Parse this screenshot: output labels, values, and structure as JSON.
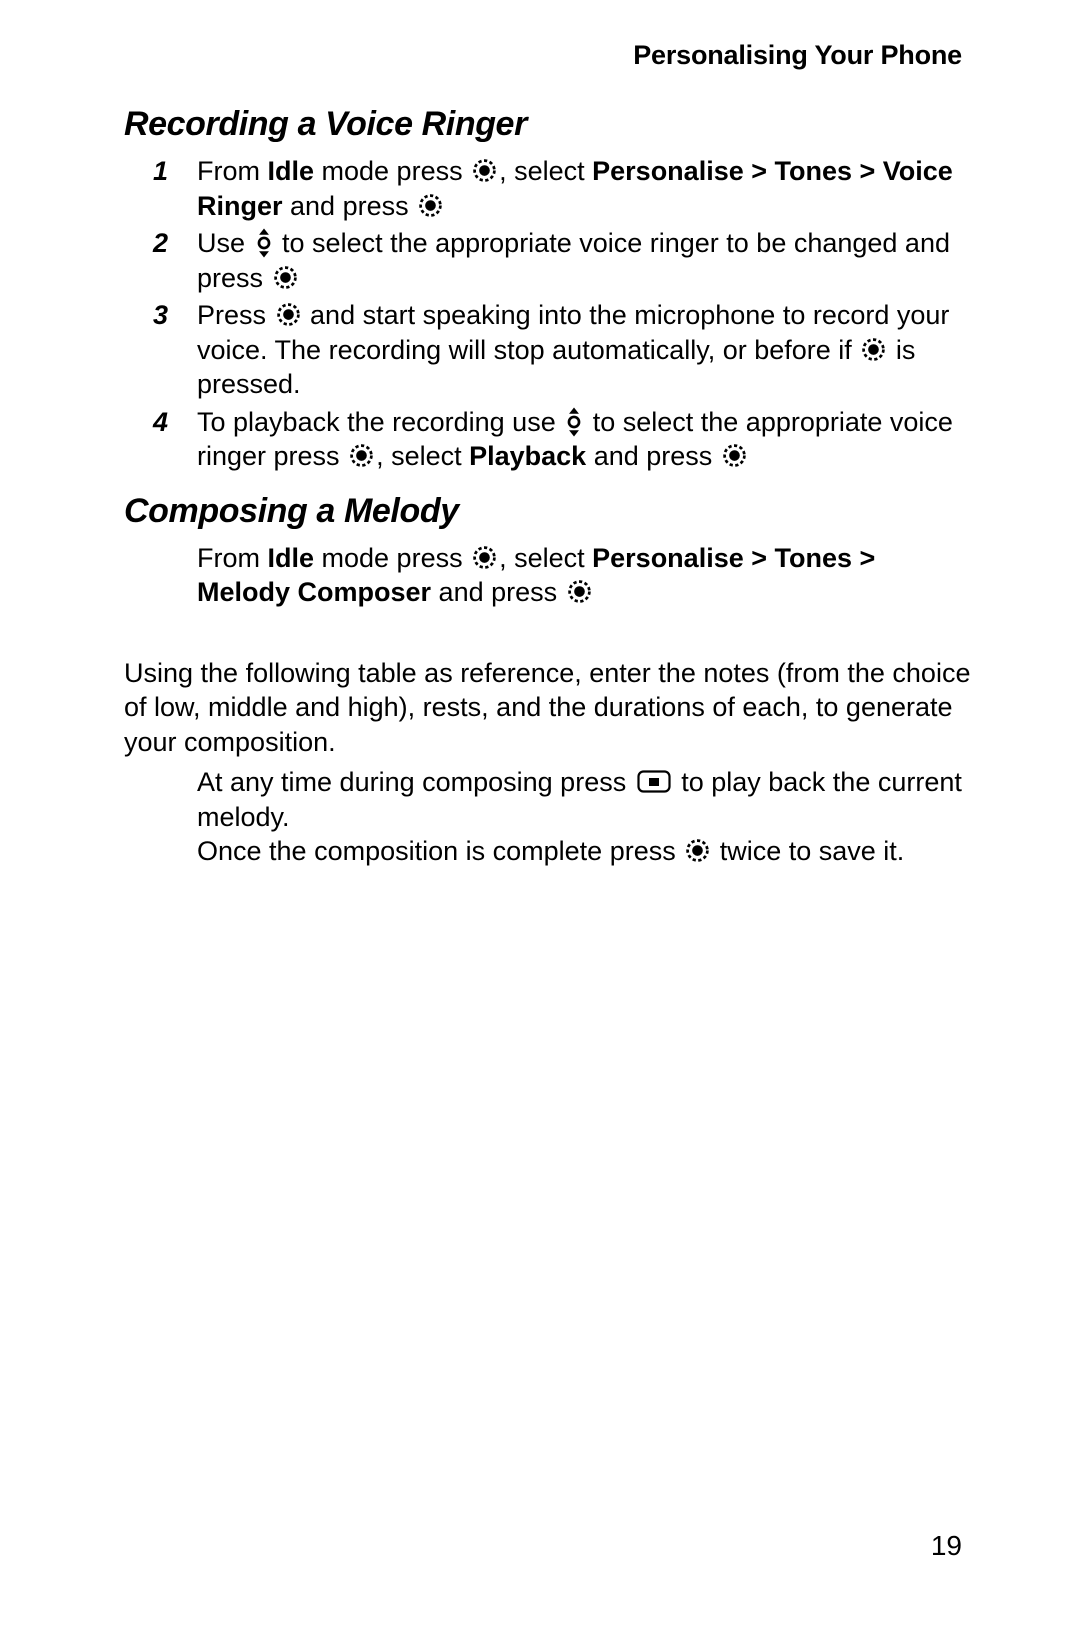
{
  "header": {
    "title": "Personalising Your Phone"
  },
  "sections": [
    {
      "heading": "Recording a Voice Ringer",
      "steps": [
        {
          "number": "1",
          "parts": [
            {
              "t": "text",
              "v": "From "
            },
            {
              "t": "bold",
              "v": "Idle"
            },
            {
              "t": "text",
              "v": " mode press "
            },
            {
              "t": "icon",
              "v": "select-key-icon"
            },
            {
              "t": "text",
              "v": ", select "
            },
            {
              "t": "bold",
              "v": "Personalise > Tones > Voice Ringer"
            },
            {
              "t": "text",
              "v": " and press "
            },
            {
              "t": "icon",
              "v": "select-key-icon"
            }
          ]
        },
        {
          "number": "2",
          "parts": [
            {
              "t": "text",
              "v": "Use "
            },
            {
              "t": "icon",
              "v": "up-down-key-icon"
            },
            {
              "t": "text",
              "v": " to select the appropriate voice ringer to be changed and press "
            },
            {
              "t": "icon",
              "v": "select-key-icon"
            }
          ]
        },
        {
          "number": "3",
          "parts": [
            {
              "t": "text",
              "v": "Press "
            },
            {
              "t": "icon",
              "v": "select-key-icon"
            },
            {
              "t": "text",
              "v": " and start speaking into the microphone to record your voice. The recording will stop automatically, or before if "
            },
            {
              "t": "icon",
              "v": "select-key-icon"
            },
            {
              "t": "text",
              "v": " is pressed."
            }
          ]
        },
        {
          "number": "4",
          "parts": [
            {
              "t": "text",
              "v": "To playback the recording use "
            },
            {
              "t": "icon",
              "v": "up-down-key-icon"
            },
            {
              "t": "text",
              "v": " to select the appropriate voice ringer press "
            },
            {
              "t": "icon",
              "v": "select-key-icon"
            },
            {
              "t": "text",
              "v": ", select "
            },
            {
              "t": "bold",
              "v": "Playback"
            },
            {
              "t": "text",
              "v": " and press "
            },
            {
              "t": "icon",
              "v": "select-key-icon"
            }
          ]
        }
      ]
    },
    {
      "heading": "Composing a Melody",
      "intro": [
        {
          "t": "text",
          "v": "From "
        },
        {
          "t": "bold",
          "v": "Idle"
        },
        {
          "t": "text",
          "v": " mode press "
        },
        {
          "t": "icon",
          "v": "select-key-icon"
        },
        {
          "t": "text",
          "v": ", select "
        },
        {
          "t": "bold",
          "v": "Personalise > Tones > Melody Composer"
        },
        {
          "t": "text",
          "v": " and press "
        },
        {
          "t": "icon",
          "v": "select-key-icon"
        }
      ],
      "body": [
        {
          "t": "text",
          "v": "Using the following table as reference, enter the notes (from the choice of low, middle and high), rests, and the durations of each, to generate your composition."
        }
      ],
      "notes": [
        [
          {
            "t": "text",
            "v": "At any time during composing press "
          },
          {
            "t": "icon",
            "v": "soft-key-icon"
          },
          {
            "t": "text",
            "v": " to play back the current melody."
          }
        ],
        [
          {
            "t": "text",
            "v": "Once the composition is complete press "
          },
          {
            "t": "icon",
            "v": "select-key-icon"
          },
          {
            "t": "text",
            "v": " twice to save it."
          }
        ]
      ]
    }
  ],
  "footer": {
    "page_number": "19"
  },
  "colors": {
    "text": "#000000",
    "background": "#ffffff"
  }
}
